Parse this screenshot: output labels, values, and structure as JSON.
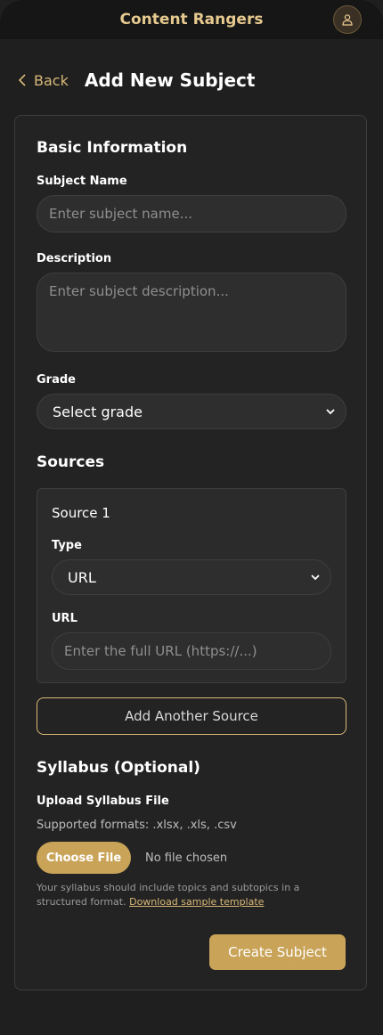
{
  "app": {
    "title": "Content Rangers",
    "avatar_icon": "user-icon"
  },
  "header": {
    "back_label": "Back",
    "back_icon": "chevron-left-icon",
    "title": "Add New Subject"
  },
  "basic": {
    "title": "Basic Information",
    "subject_name_label": "Subject Name",
    "subject_name_placeholder": "Enter subject name...",
    "subject_name_value": "",
    "description_label": "Description",
    "description_placeholder": "Enter subject description...",
    "description_value": "",
    "grade_label": "Grade",
    "grade_selected": "Select grade"
  },
  "sources": {
    "title": "Sources",
    "items": [
      {
        "title": "Source 1",
        "type_label": "Type",
        "type_selected": "URL",
        "url_label": "URL",
        "url_placeholder": "Enter the full URL (https://...)",
        "url_value": ""
      }
    ],
    "add_label": "Add Another Source"
  },
  "syllabus": {
    "title": "Syllabus (Optional)",
    "upload_label": "Upload Syllabus File",
    "formats": "Supported formats: .xlsx, .xls, .csv",
    "choose_label": "Choose File",
    "no_file": "No file chosen",
    "help_text": "Your syllabus should include topics and subtopics in a structured format.",
    "help_link": "Download sample template"
  },
  "actions": {
    "create_label": "Create Subject"
  },
  "colors": {
    "accent": "#c9a458",
    "accent_text": "#e6c98f",
    "background": "#1f1f1f",
    "card": "#232323"
  }
}
